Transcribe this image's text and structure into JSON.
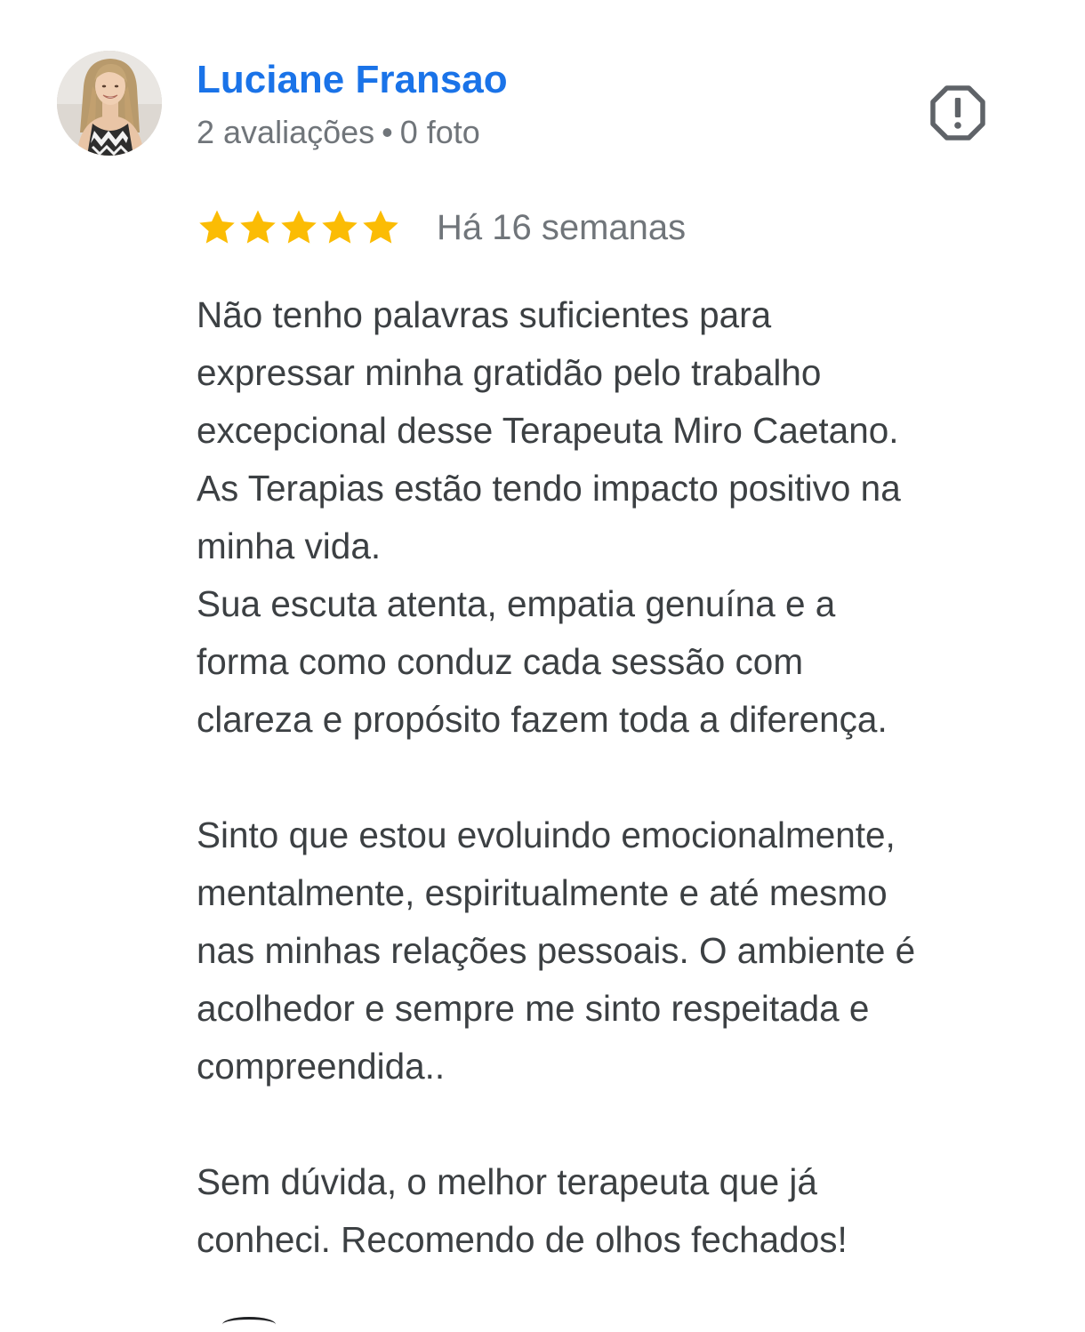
{
  "reviewer": {
    "name": "Luciane Fransao",
    "reviews_count": "2 avaliações",
    "separator": "•",
    "photos_count": "0 foto"
  },
  "report_icon": "report-octagon-icon",
  "rating": {
    "stars": 5,
    "max_stars": 5,
    "star_color": "#fbbc04",
    "date": "Há 16 semanas"
  },
  "review": {
    "lines": [
      "Não tenho palavras suficientes para",
      "expressar minha gratidão pelo trabalho",
      "excepcional desse Terapeuta Miro Caetano.",
      "As Terapias estão tendo impacto positivo na",
      "minha vida.",
      "Sua escuta atenta, empatia genuína e a",
      "forma como conduz cada sessão com",
      "clareza e propósito fazem toda a diferença.",
      "",
      "Sinto que estou evoluindo emocionalmente,",
      "mentalmente, espiritualmente e até mesmo",
      "nas minhas relações pessoais. O ambiente é",
      "acolhedor e sempre me sinto respeitada e",
      "compreendida..",
      "",
      "Sem dúvida, o melhor terapeuta que já",
      "conheci. Recomendo de olhos fechados!"
    ]
  },
  "colors": {
    "name": "#1a73e8",
    "meta": "#70757a",
    "body_text": "#3c4043"
  }
}
